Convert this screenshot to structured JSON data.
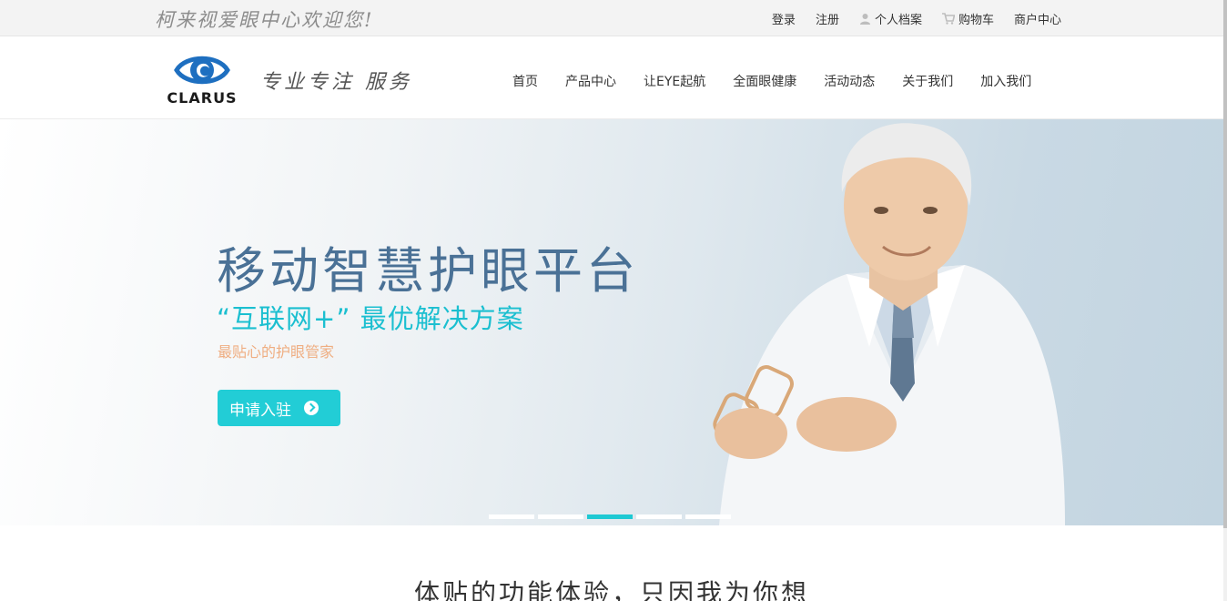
{
  "topbar": {
    "welcome": "柯来视爱眼中心欢迎您!",
    "links": [
      {
        "label": "登录",
        "icon": null
      },
      {
        "label": "注册",
        "icon": null
      },
      {
        "label": "个人档案",
        "icon": "user-icon"
      },
      {
        "label": "购物车",
        "icon": "cart-icon"
      },
      {
        "label": "商户中心",
        "icon": null
      }
    ]
  },
  "header": {
    "logo_text": "CLARUS",
    "slogan": "专业专注 服务",
    "nav": [
      "首页",
      "产品中心",
      "让EYE起航",
      "全面眼健康",
      "活动动态",
      "关于我们",
      "加入我们"
    ]
  },
  "hero": {
    "title": "移动智慧护眼平台",
    "subtitle": "“互联网+”  最优解决方案",
    "tagline": "最贴心的护眼管家",
    "button_label": "申请入驻",
    "slides_count": 5,
    "active_slide": 3
  },
  "section": {
    "title": "体贴的功能体验，只因我为你想"
  },
  "colors": {
    "accent": "#22cdd6",
    "title_blue": "#4a7196",
    "tagline_orange": "#efae82",
    "logo_blue": "#1e6fc0"
  }
}
